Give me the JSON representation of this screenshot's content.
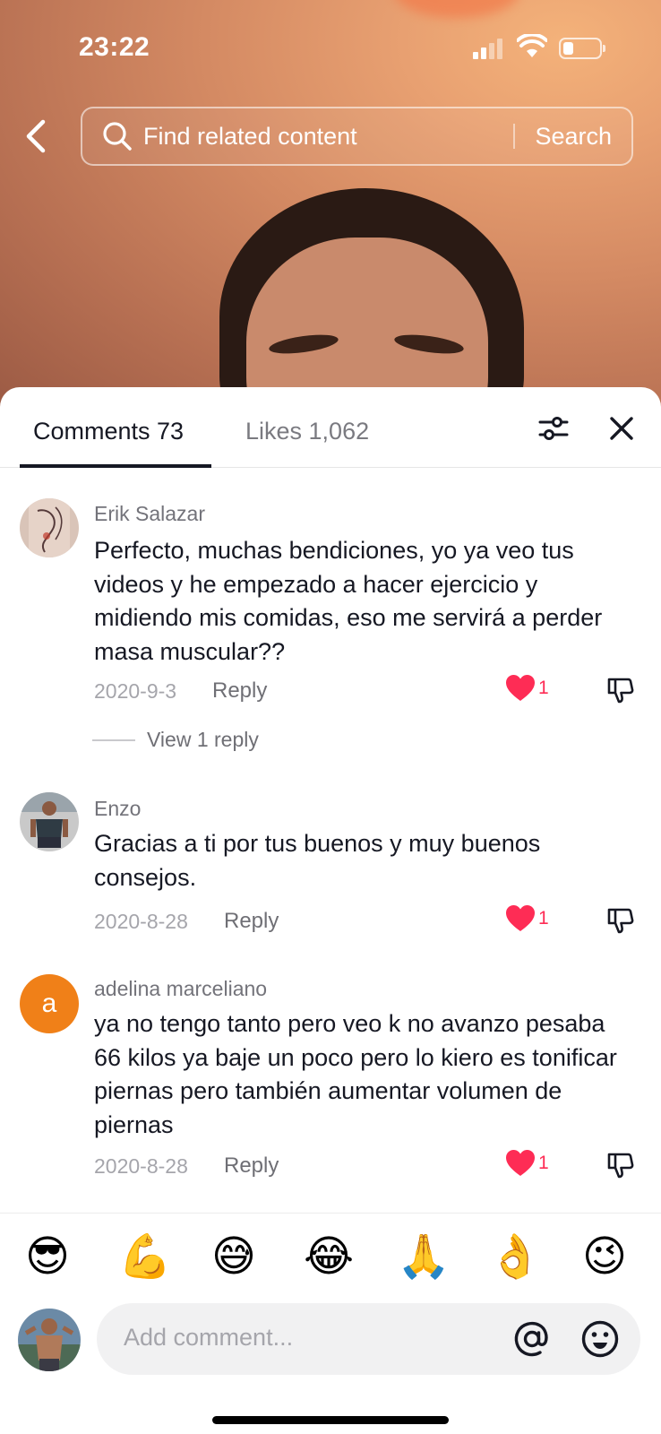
{
  "status_bar": {
    "time": "23:22"
  },
  "search": {
    "placeholder": "Find related content",
    "button_label": "Search"
  },
  "tabs": [
    {
      "label": "Comments 73",
      "active": true
    },
    {
      "label": "Likes 1,062",
      "active": false
    }
  ],
  "comments": [
    {
      "username": "Erik Salazar",
      "text": "Perfecto, muchas bendiciones, yo ya veo tus videos y he empezado a hacer ejercicio y midiendo mis comidas, eso me servirá a perder masa muscular??",
      "date": "2020-9-3",
      "reply_label": "Reply",
      "likes": "1",
      "view_replies": "View 1 reply"
    },
    {
      "username": "Enzo",
      "text": "Gracias a ti por tus buenos y muy buenos consejos.",
      "date": "2020-8-28",
      "reply_label": "Reply",
      "likes": "1"
    },
    {
      "username": "adelina marceliano",
      "avatar_letter": "a",
      "text": "ya no tengo tanto pero veo k no avanzo pesaba 66 kilos ya baje un poco pero lo kiero es tonificar piernas pero también aumentar volumen de piernas",
      "date": "2020-8-28",
      "reply_label": "Reply",
      "likes": "1"
    }
  ],
  "quick_emojis": [
    "😎",
    "💪",
    "😅",
    "😂",
    "🙏",
    "👌",
    "😉"
  ],
  "composer": {
    "placeholder": "Add comment..."
  },
  "colors": {
    "like_red": "#fe2c55",
    "avatar_orange": "#f08018",
    "text_primary": "#161823"
  },
  "icons": [
    "back-icon",
    "search-icon",
    "filter-icon",
    "close-icon",
    "heart-icon",
    "dislike-icon",
    "at-icon",
    "emoji-icon"
  ]
}
